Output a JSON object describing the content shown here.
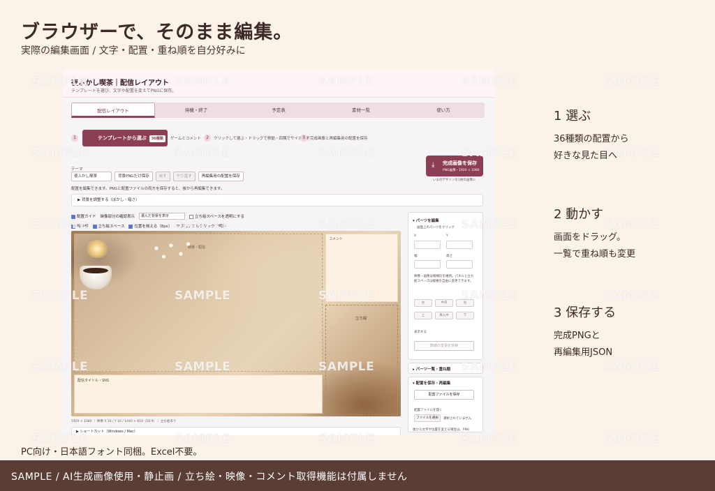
{
  "hero": {
    "title": "ブラウザーで、そのまま編集。",
    "subtitle": "実際の編集画面 / 文字・配置・重ね順を自分好みに"
  },
  "app": {
    "title": "夜ふかし喫茶｜配信レイアウト",
    "description": "テンプレートを選び、文字や配置を変えてPNGに保存。",
    "tabs": [
      "配信レイアウト",
      "待機・終了",
      "予定表",
      "素材一覧",
      "使い方"
    ],
    "steps": {
      "n1": "1",
      "template_button": "テンプレートから選ぶ",
      "template_badge": "36種類",
      "template_caption": "ゲームとコメント",
      "n2": "2",
      "drag_label": "クリックして選ぶ・ドラッグで移動・四隅でサイズ変更",
      "n3": "3",
      "save_label": "完成画像と再編集用の配置を保存"
    },
    "save_main": {
      "label": "完成画像を保存",
      "sub": "PNG画像・1920 × 1080",
      "note": "いまのデザインを1枚の画像に"
    },
    "theme": {
      "label": "テーマ",
      "selected": "夜ふかし喫茶",
      "buttons": [
        "背景PNGだけ保存",
        "戻す",
        "やり直す",
        "再編集用の配置を保存"
      ]
    },
    "info_line": "配置を編集できます。PNGと配置ファイルの両方を保存すると、後から再編集できます。",
    "bg_panel": "▶ 背景を調整する（ぼかし・暗さ）",
    "guides": {
      "guide": "配置ガイド",
      "video_check": "映像部分の確認表示",
      "video_select": "選んだ背景を表示",
      "transparent": "立ち絵スペースを透明にする",
      "snap": "吸着枠",
      "stand_space": "立ち絵スペース",
      "align": "位置を揃える（8px）",
      "text_note": "文字はダブルクリックで編集"
    },
    "canvas": {
      "main_label": "映像・配信",
      "comment_label": "コメント",
      "stand_label": "立ち絵",
      "title_label": "配信タイトル・SNS",
      "dimensions": "1920 × 1080 ｜ 映像 X 16 / Y 16 / 1440 × 810（16:9）｜ 立ち絵あり",
      "sub_panel": "▶ ショートカット（Windows / Mac）"
    },
    "side": {
      "parts_edit": "▾ パーツを編集",
      "parts_hint": "画面上のパーツをクリック",
      "x": "X",
      "y": "Y",
      "w": "幅",
      "h": "高さ",
      "help": "映像・画像は縦横比を維持。パネルと立ち絵スペースは縦横を自由に変更できます。",
      "align_buttons": [
        "左",
        "中央",
        "右",
        "上",
        "真ん中",
        "下"
      ],
      "display": "表示する",
      "apply": "数値の変更を反映",
      "parts_list": "▸ パーツ一覧・重ね順",
      "save_edit": "▾ 配置を保存・再編集",
      "save_layout": "配置ファイルを保存",
      "open_layout": "配置ファイルを開く",
      "choose_file": "ファイルを選択",
      "no_file": "選択されていません",
      "bottom_note": "後から文字や位置を変える場合は、PNG"
    }
  },
  "watermark": "SAMPLE",
  "right_steps": [
    {
      "title": "1  選ぶ",
      "desc1": "36種類の配置から",
      "desc2": "好きな見た目へ"
    },
    {
      "title": "2  動かす",
      "desc1": "画面をドラッグ。",
      "desc2": "一覧で重ね順も変更"
    },
    {
      "title": "3  保存する",
      "desc1": "完成PNGと",
      "desc2": "再編集用JSON"
    }
  ],
  "foot_note": "PC向け・日本語フォント同梱。Excel不要。",
  "foot_bar": "SAMPLE / AI生成画像使用・静止画 / 立ち絵・映像・コメント取得機能は付属しません",
  "colors": {
    "background": "#fbf2e9",
    "accent": "#8c3e54",
    "footer": "#5a3d35"
  }
}
